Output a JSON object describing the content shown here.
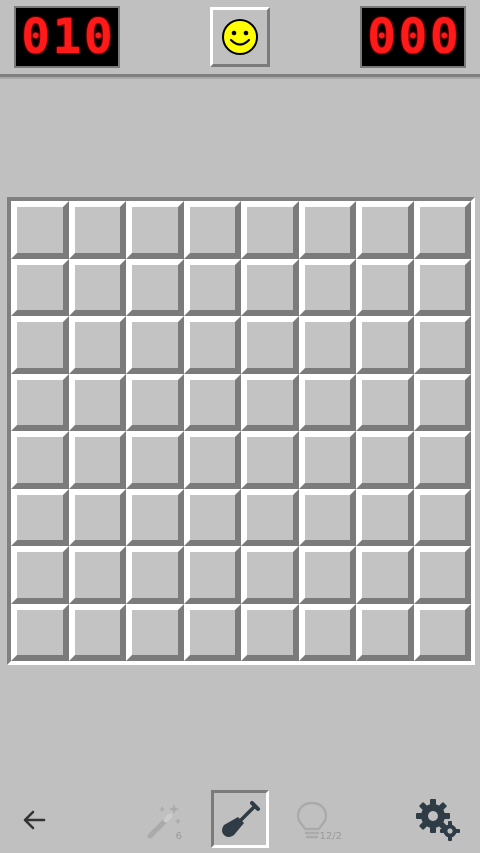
{
  "header": {
    "mine_counter": [
      "0",
      "1",
      "0"
    ],
    "timer": [
      "0",
      "0",
      "0"
    ],
    "face": "smiley"
  },
  "board": {
    "rows": 8,
    "cols": 8,
    "state": "all-covered"
  },
  "toolbar": {
    "back_icon": "back-arrow-icon",
    "magic_wand": {
      "icon": "magic-wand-icon",
      "count": "6"
    },
    "shovel": {
      "icon": "shovel-icon",
      "selected": true
    },
    "hint": {
      "icon": "lightbulb-icon",
      "count": "12/2"
    },
    "settings_icon": "gears-icon"
  },
  "colors": {
    "background": "#c0c0c0",
    "led_red": "#ff1a1a",
    "smiley_yellow": "#ffff00"
  }
}
